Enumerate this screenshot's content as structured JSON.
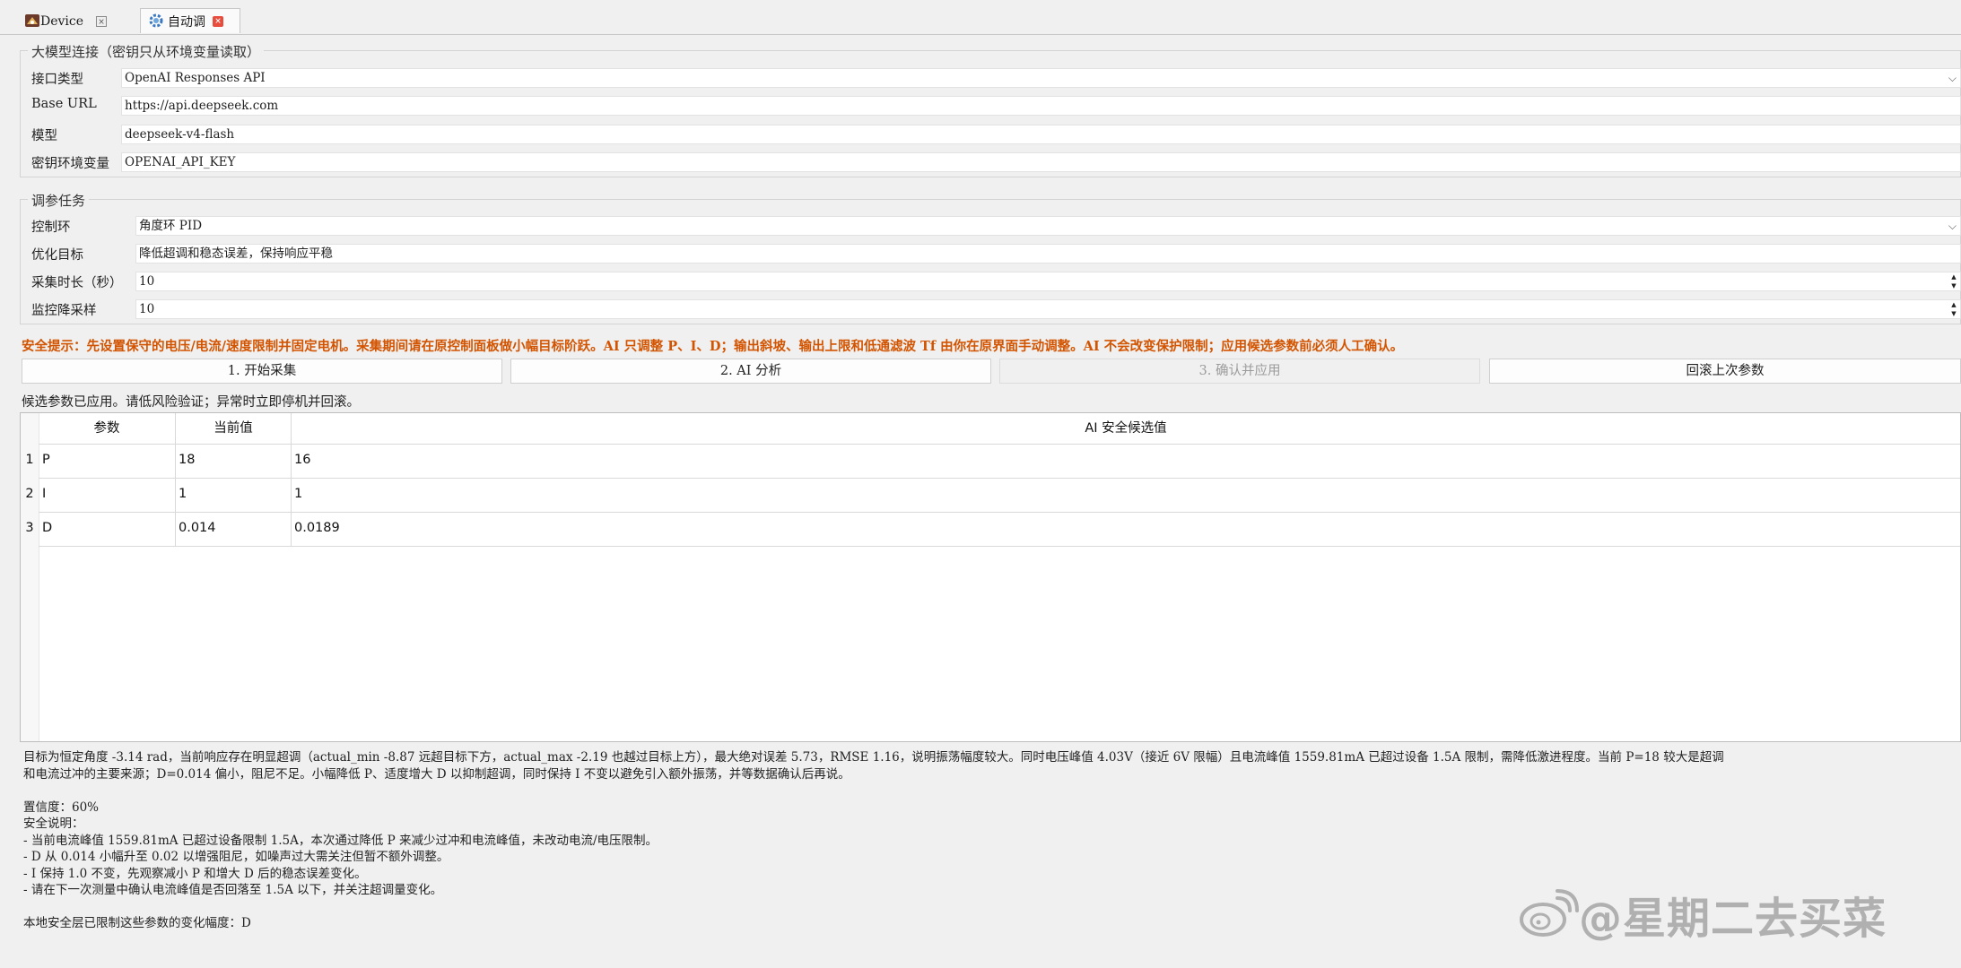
{
  "tabs": [
    {
      "label": "Device",
      "active": false,
      "icon": "device-icon"
    },
    {
      "label": "自动调",
      "active": true,
      "icon": "gear-icon"
    }
  ],
  "model_group": {
    "title": "大模型连接（密钥只从环境变量读取）",
    "api_type_label": "接口类型",
    "api_type_value": "OpenAI Responses API",
    "base_url_label": "Base URL",
    "base_url_value": "https://api.deepseek.com",
    "model_label": "模型",
    "model_value": "deepseek-v4-flash",
    "key_env_label": "密钥环境变量",
    "key_env_value": "OPENAI_API_KEY"
  },
  "task_group": {
    "title": "调参任务",
    "loop_label": "控制环",
    "loop_value": "角度环 PID",
    "goal_label": "优化目标",
    "goal_value": "降低超调和稳态误差，保持响应平稳",
    "duration_label": "采集时长（秒）",
    "duration_value": "10",
    "downsample_label": "监控降采样",
    "downsample_value": "10"
  },
  "warning": "安全提示：先设置保守的电压/电流/速度限制并固定电机。采集期间请在原控制面板做小幅目标阶跃。AI 只调整 P、I、D；输出斜坡、输出上限和低通滤波 Tf 由你在原界面手动调整。AI 不会改变保护限制；应用候选参数前必须人工确认。",
  "buttons": {
    "start": "1. 开始采集",
    "analyze": "2. AI 分析",
    "confirm": "3. 确认并应用",
    "rollback": "回滚上次参数"
  },
  "status": "候选参数已应用。请低风险验证；异常时立即停机并回滚。",
  "table": {
    "headers": [
      "参数",
      "当前值",
      "AI 安全候选值"
    ],
    "rows": [
      {
        "num": "1",
        "param": "P",
        "current": "18",
        "candidate": "16"
      },
      {
        "num": "2",
        "param": "I",
        "current": "1",
        "candidate": "1"
      },
      {
        "num": "3",
        "param": "D",
        "current": "0.014",
        "candidate": "0.0189"
      }
    ]
  },
  "analysis": {
    "line1": "目标为恒定角度 -3.14 rad，当前响应存在明显超调（actual_min -8.87 远超目标下方，actual_max -2.19 也越过目标上方），最大绝对误差 5.73，RMSE 1.16，说明振荡幅度较大。同时电压峰值 4.03V（接近 6V 限幅）且电流峰值 1559.81mA 已超过设备 1.5A 限制，需降低激进程度。当前 P=18 较大是超调",
    "line2": "和电流过冲的主要来源；D=0.014 偏小，阻尼不足。小幅降低 P、适度增大 D 以抑制超调，同时保持 I 不变以避免引入额外振荡，并等数据确认后再说。",
    "confidence": "置信度：60%",
    "safety_title": "安全说明：",
    "safety_1": "- 当前电流峰值 1559.81mA 已超过设备限制 1.5A，本次通过降低 P 来减少过冲和电流峰值，未改动电流/电压限制。",
    "safety_2": "- D 从 0.014 小幅升至 0.02 以增强阻尼，如噪声过大需关注但暂不额外调整。",
    "safety_3": "- I 保持 1.0 不变，先观察减小 P 和增大 D 后的稳态误差变化。",
    "safety_4": "- 请在下一次测量中确认电流峰值是否回落至 1.5A 以下，并关注超调量变化。",
    "footer": "本地安全层已限制这些参数的变化幅度：D"
  },
  "watermark": "@星期二去买菜"
}
